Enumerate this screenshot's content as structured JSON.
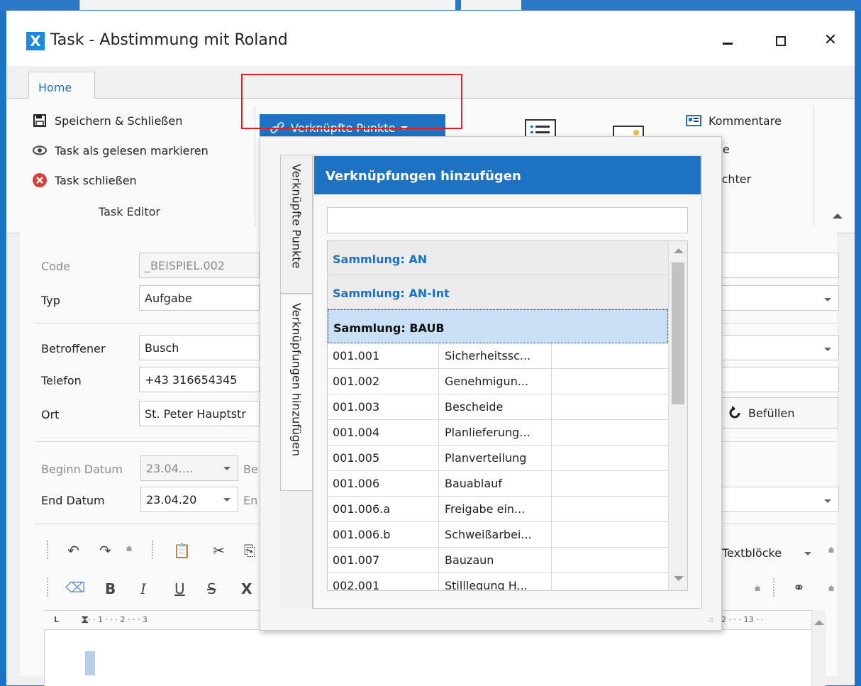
{
  "window": {
    "title": "Task - Abstimmung mit Roland",
    "app_icon": "X",
    "close_glyph": "✕"
  },
  "ribbon": {
    "tab_home": "Home",
    "save_close": "Speichern & Schließen",
    "mark_read": "Task als gelesen markieren",
    "close_task": "Task schließen",
    "group_label": "Task Editor",
    "linked_points": "Verknüpfte Punkte",
    "comments": "Kommentare",
    "history": "Historie",
    "observers": "Beobachter"
  },
  "form": {
    "code_label": "Code",
    "code_value": "_BEISPIEL.002",
    "type_label": "Typ",
    "type_value": "Aufgabe",
    "affected_label": "Betroffener",
    "affected_value": "Busch",
    "phone_label": "Telefon",
    "phone_value": "+43 316654345",
    "place_label": "Ort",
    "place_value": "St. Peter Hauptstr",
    "fill_button": "Befüllen",
    "start_date_label": "Beginn Datum",
    "start_date_value": "23.04....",
    "start_time_label_partial": "Be",
    "end_date_label": "End Datum",
    "end_date_value": "23.04.20",
    "end_time_label_partial": "En",
    "text_blocks": "Textblöcke"
  },
  "ruler": {
    "left": "·  ·  1  ·  ·  ·  2  ·  ·  ·  3",
    "right": "2  ·  ·  ·  13  ·  ·"
  },
  "popup": {
    "vtab_linked": "Verknüpfte Punkte",
    "vtab_add": "Verknüpfungen hinzufügen",
    "header": "Verknüpfungen hinzufügen",
    "search_value": "",
    "groups": [
      {
        "label": "Sammlung: AN"
      },
      {
        "label": "Sammlung: AN-Int"
      },
      {
        "label": "Sammlung: BAUB"
      }
    ],
    "rows": [
      {
        "code": "001.001",
        "name": "Sicherheitssc..."
      },
      {
        "code": "001.002",
        "name": "Genehmigun..."
      },
      {
        "code": "001.003",
        "name": "Bescheide"
      },
      {
        "code": "001.004",
        "name": "Planlieferung..."
      },
      {
        "code": "001.005",
        "name": "Planverteilung"
      },
      {
        "code": "001.006",
        "name": "Bauablauf"
      },
      {
        "code": "001.006.a",
        "name": "Freigabe ein..."
      },
      {
        "code": "001.006.b",
        "name": "Schweißarbei..."
      },
      {
        "code": "001.007",
        "name": "Bauzaun"
      },
      {
        "code": "002.001",
        "name": "Stilllegung H..."
      }
    ]
  },
  "toolbar": {
    "bold": "B",
    "italic": "I",
    "underline": "U",
    "strike": "S",
    "clear": "X"
  },
  "colors": {
    "accent": "#1e72c4",
    "highlight_box": "#e02020",
    "selected_row": "#c9dff5"
  }
}
